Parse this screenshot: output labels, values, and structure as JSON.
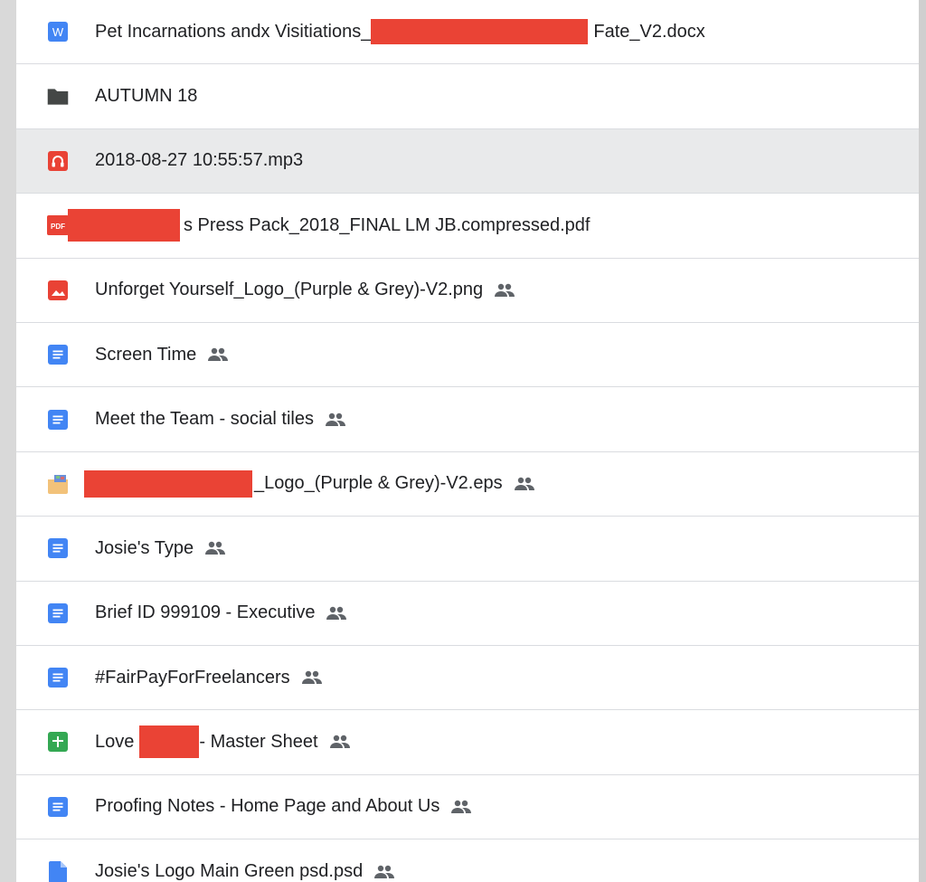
{
  "colors": {
    "row_selected": "#e9eaeb",
    "divider": "#dadce0",
    "redaction": "#ea4335",
    "docs_blue": "#4285f4",
    "sheets_green": "#34a853",
    "red_icon": "#e94235",
    "folder_gray": "#444746"
  },
  "files": [
    {
      "icon": "word-doc-icon",
      "name_prefix": "Pet Incarnations andx Visitiations_",
      "name_suffix": "Fate_V2.docx",
      "shared": false
    },
    {
      "icon": "folder-icon",
      "name": "AUTUMN 18",
      "shared": false
    },
    {
      "icon": "audio-file-icon",
      "name": "2018-08-27 10:55:57.mp3",
      "shared": false,
      "selected": true
    },
    {
      "icon": "pdf-icon",
      "name_suffix": "s Press Pack_2018_FINAL LM JB.compressed.pdf",
      "shared": false
    },
    {
      "icon": "image-icon",
      "name": "Unforget Yourself_Logo_(Purple & Grey)-V2.png",
      "shared": true
    },
    {
      "icon": "google-docs-icon",
      "name": "Screen Time",
      "shared": true
    },
    {
      "icon": "google-docs-icon",
      "name": "Meet the Team - social tiles",
      "shared": true
    },
    {
      "icon": "eps-file-icon",
      "name_suffix": "_Logo_(Purple & Grey)-V2.eps",
      "shared": true
    },
    {
      "icon": "google-docs-icon",
      "name": "Josie's Type",
      "shared": true
    },
    {
      "icon": "google-docs-icon",
      "name": "Brief ID 999109 - Executive",
      "shared": true
    },
    {
      "icon": "google-docs-icon",
      "name": "#FairPayForFreelancers",
      "shared": true
    },
    {
      "icon": "google-sheets-icon",
      "name_prefix": "Love ",
      "name_suffix": " - Master Sheet",
      "shared": true
    },
    {
      "icon": "google-docs-icon",
      "name": "Proofing Notes - Home Page and About Us",
      "shared": true
    },
    {
      "icon": "generic-file-icon",
      "name": "Josie's Logo Main Green psd.psd",
      "shared": true
    }
  ]
}
